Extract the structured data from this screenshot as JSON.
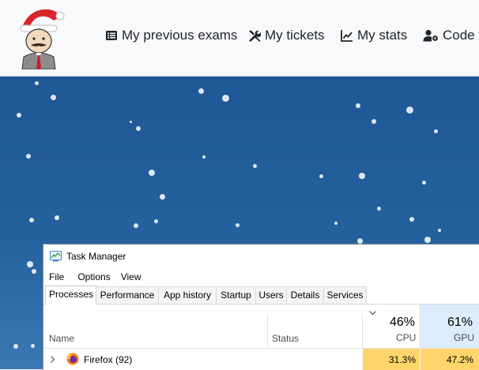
{
  "nav": {
    "items": [
      {
        "label": "My previous exams",
        "icon": "list-icon"
      },
      {
        "label": "My tickets",
        "icon": "tools-icon"
      },
      {
        "label": "My stats",
        "icon": "chart-line-icon"
      },
      {
        "label": "Code t",
        "icon": "user-gear-icon"
      }
    ],
    "mascot": "santa-hat-mascot"
  },
  "task_manager": {
    "title": "Task Manager",
    "menu": [
      "File",
      "Options",
      "View"
    ],
    "tabs": [
      "Processes",
      "Performance",
      "App history",
      "Startup",
      "Users",
      "Details",
      "Services"
    ],
    "active_tab": "Processes",
    "columns": {
      "name": "Name",
      "status": "Status",
      "cpu": {
        "label": "CPU",
        "percent": "46%"
      },
      "gpu": {
        "label": "GPU",
        "percent": "61%"
      }
    },
    "rows": [
      {
        "name": "Firefox (92)",
        "cpu": "31.3%",
        "gpu": "47.2%"
      }
    ]
  },
  "colors": {
    "background_blue": "#1f5797",
    "heat_cell": "#ffd46a",
    "gpu_header": "#dcecfc"
  }
}
